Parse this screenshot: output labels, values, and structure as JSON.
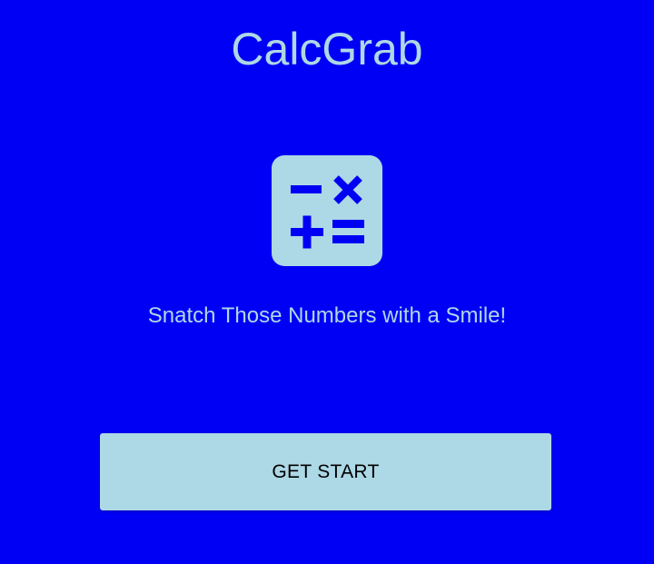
{
  "app": {
    "title": "CalcGrab",
    "tagline": "Snatch Those Numbers with a Smile!",
    "logo_icon": "calculator-operators-icon"
  },
  "actions": {
    "start_label": "GET START"
  },
  "colors": {
    "background": "#0000f5",
    "accent": "#add8e6",
    "icon_glyph": "#0000f5",
    "button_text": "#000000"
  }
}
